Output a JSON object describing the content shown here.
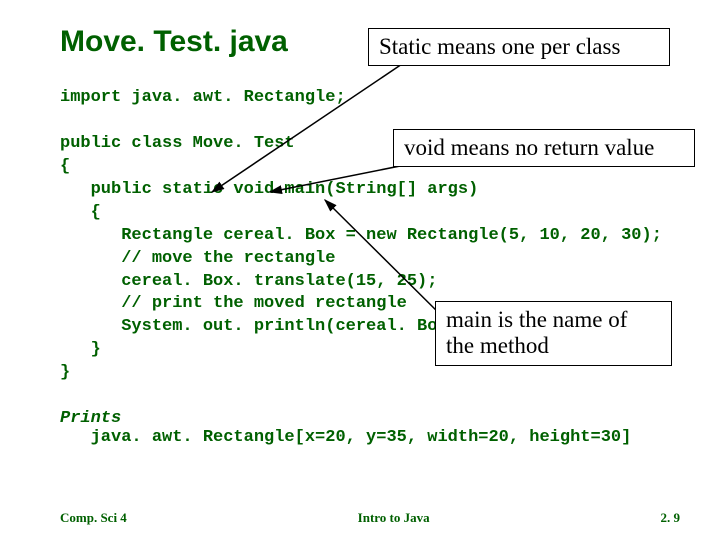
{
  "title": "Move. Test. java",
  "callouts": {
    "static": "Static means one per class",
    "void": "void means no return value",
    "main": "main is the name of the method"
  },
  "code": "import java. awt. Rectangle;\n\npublic class Move. Test\n{\n   public static void main(String[] args)\n   {\n      Rectangle cereal. Box = new Rectangle(5, 10, 20, 30);\n      // move the rectangle\n      cereal. Box. translate(15, 25);\n      // print the moved rectangle\n      System. out. println(cereal. Box);\n   }\n}",
  "prints_label": "Prints",
  "prints_value": "   java. awt. Rectangle[x=20, y=35, width=20, height=30]",
  "footer": {
    "left": "Comp. Sci 4",
    "center": "Intro to Java",
    "right": "2. 9"
  }
}
